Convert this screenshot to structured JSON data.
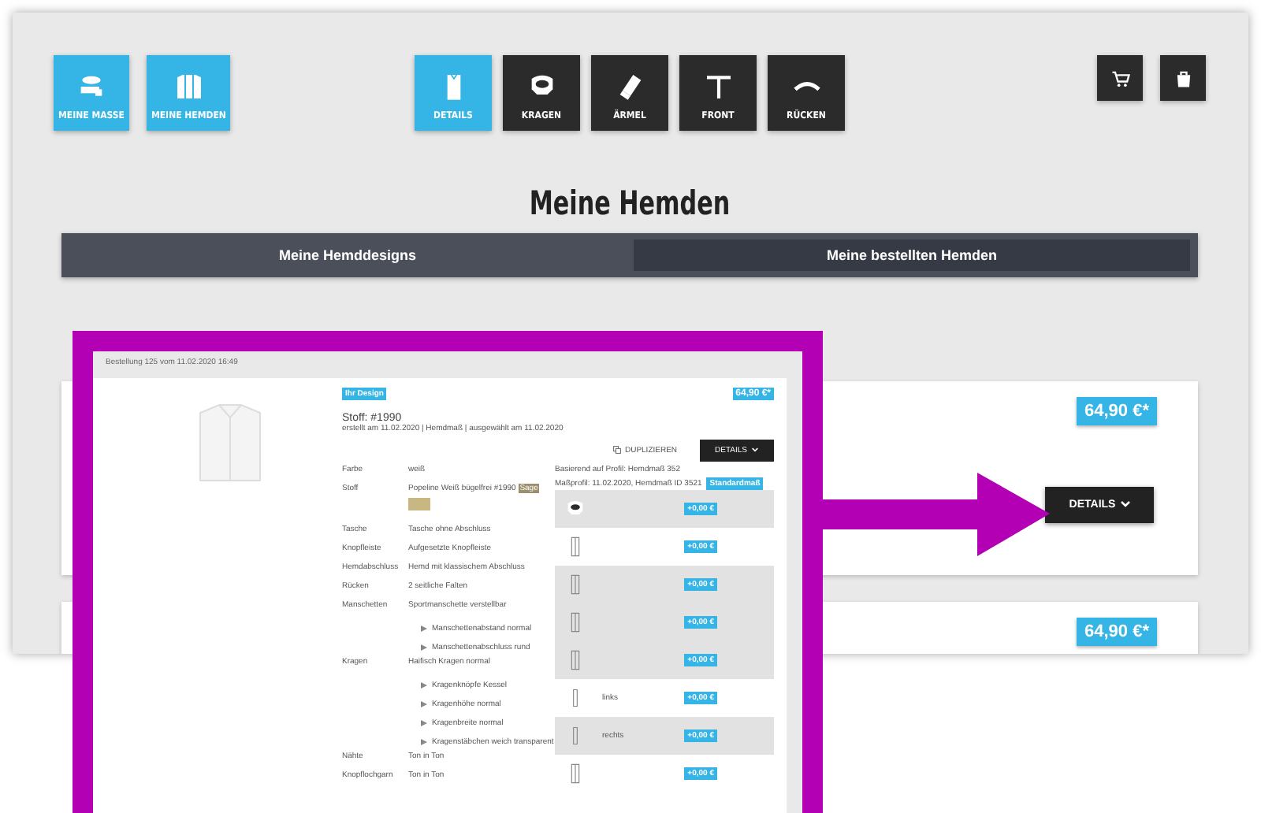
{
  "toolbar": {
    "left": [
      {
        "label": "MEINE MASSE",
        "kind": "tape"
      },
      {
        "label": "MEINE HEMDEN",
        "kind": "shirts"
      }
    ],
    "steps": [
      {
        "label": "DETAILS",
        "kind": "shirt",
        "selected": true
      },
      {
        "label": "KRAGEN",
        "kind": "collar",
        "selected": false
      },
      {
        "label": "ÄRMEL",
        "kind": "sleeve",
        "selected": false
      },
      {
        "label": "FRONT",
        "kind": "front",
        "selected": false
      },
      {
        "label": "RÜCKEN",
        "kind": "back",
        "selected": false
      }
    ],
    "right": [
      {
        "kind": "cart"
      },
      {
        "kind": "bag"
      }
    ]
  },
  "title": "Meine Hemden",
  "tabs": [
    {
      "label": "Meine Hemddesigns",
      "selected": false
    },
    {
      "label": "Meine bestellten Hemden",
      "selected": true
    }
  ],
  "orders": [
    {
      "price": "64,90 €*",
      "button": "DETAILS"
    },
    {
      "price": "64,90 €*"
    }
  ],
  "zoom": {
    "caption": "Bestellung 125 vom 11.02.2020 16:49",
    "badge": "Ihr Design",
    "price": "64,90 €*",
    "heading": "Stoff: #1990",
    "subline": "erstellt am 11.02.2020 | Hemdmaß | ausgewählt am 11.02.2020",
    "duplicate": "DUPLIZIEREN",
    "details": "DETAILS",
    "rows": [
      {
        "kind": "pair",
        "label": "Farbe",
        "value": "weiß"
      },
      {
        "kind": "fabric",
        "label": "Stoff",
        "value": "Popeline Weiß bügelfrei #1990",
        "tag": "Sage"
      },
      {
        "kind": "pair",
        "label": "Tasche",
        "value": "Tasche ohne Abschluss"
      },
      {
        "kind": "pair",
        "label": "Knopfleiste",
        "value": "Aufgesetzte Knopfleiste"
      },
      {
        "kind": "pair",
        "label": "Hemdabschluss",
        "value": "Hemd mit klassischem Abschluss"
      },
      {
        "kind": "pair",
        "label": "Rücken",
        "value": "2 seitliche Falten"
      },
      {
        "kind": "pair",
        "label": "Manschetten",
        "value": "Sportmanschette verstellbar"
      },
      {
        "kind": "sub",
        "value": "Manschettenabstand normal"
      },
      {
        "kind": "sub",
        "value": "Manschettenabschluss rund"
      },
      {
        "kind": "pair",
        "label": "Kragen",
        "value": "Haifisch Kragen normal"
      },
      {
        "kind": "sub",
        "value": "Kragenknöpfe Kessel"
      },
      {
        "kind": "sub",
        "value": "Kragenhöhe normal"
      },
      {
        "kind": "sub",
        "value": "Kragenbreite normal"
      },
      {
        "kind": "sub",
        "value": "Kragenstäbchen weich transparent"
      },
      {
        "kind": "pair",
        "label": "Nähte",
        "value": "Ton in Ton"
      },
      {
        "kind": "pair",
        "label": "Knopflochgarn",
        "value": "Ton in Ton"
      }
    ],
    "profile": "Basierend auf Profil: Hemdmaß 352",
    "measure": "Maßprofil: 11.02.2020, Hemdmaß ID 3521",
    "measure_badge": "Standardmaß",
    "options": [
      {
        "kind": "collar",
        "price": "+0,00 €",
        "shaded": true
      },
      {
        "kind": "placket",
        "price": "+0,00 €",
        "shaded": false
      },
      {
        "kind": "placket",
        "price": "+0,00 €",
        "shaded": true
      },
      {
        "kind": "placket",
        "price": "+0,00 €",
        "shaded": true
      },
      {
        "kind": "placket",
        "price": "+0,00 €",
        "shaded": true
      },
      {
        "kind": "cuff",
        "text": "links",
        "price": "+0,00 €",
        "shaded": false
      },
      {
        "kind": "cuff",
        "text": "rechts",
        "price": "+0,00 €",
        "shaded": true
      },
      {
        "kind": "placket",
        "price": "+0,00 €",
        "shaded": false
      }
    ]
  }
}
